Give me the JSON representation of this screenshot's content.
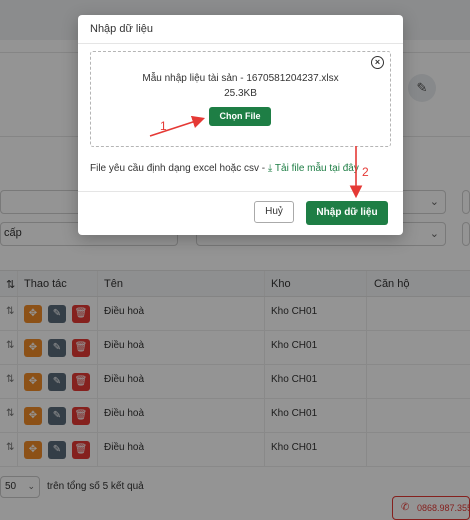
{
  "background": {
    "filter_label": "cấp",
    "table": {
      "headers": [
        "Thao tác",
        "Tên",
        "Kho",
        "Căn hộ"
      ],
      "rows": [
        {
          "name": "Điều hoà",
          "warehouse": "Kho CH01",
          "apartment": ""
        },
        {
          "name": "Điều hoà",
          "warehouse": "Kho CH01",
          "apartment": ""
        },
        {
          "name": "Điều hoà",
          "warehouse": "Kho CH01",
          "apartment": ""
        },
        {
          "name": "Điều hoà",
          "warehouse": "Kho CH01",
          "apartment": ""
        },
        {
          "name": "Điều hoà",
          "warehouse": "Kho CH01",
          "apartment": ""
        }
      ]
    },
    "pagination": {
      "page_size": "50",
      "summary": "trên tổng số 5 kết quả"
    },
    "phone": "0868.987.355"
  },
  "modal": {
    "title": "Nhập dữ liệu",
    "file_name": "Mẫu nhập liệu tài sản - 1670581204237.xlsx",
    "file_size": "25.3KB",
    "choose_button": "Chọn File",
    "hint_text": "File yêu cầu định dạng excel hoặc csv - ",
    "download_link": "Tải file mẫu tại đây",
    "cancel_button": "Huỷ",
    "import_button": "Nhập dữ liệu"
  },
  "annotations": [
    "1",
    "2"
  ],
  "colors": {
    "primary_green": "#1e7e45",
    "annotation_red": "#e53935"
  }
}
